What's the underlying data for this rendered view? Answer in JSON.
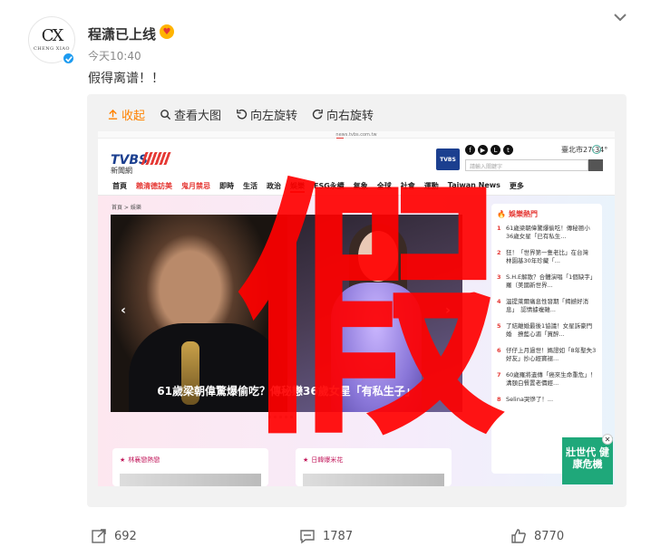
{
  "post": {
    "username": "程潇已上线",
    "avatar_mono": "CX",
    "avatar_sub": "CHENG XIAO",
    "time": "今天10:40",
    "text": "假得离谱！！"
  },
  "toolbar": {
    "collapse": "收起",
    "view_large": "查看大图",
    "rotate_left": "向左旋转",
    "rotate_right": "向右旋转"
  },
  "screenshot": {
    "url": "news.tvbs.com.tw",
    "logo": "TVBS",
    "logo_sub": "新聞網",
    "box_logo": "TVBS",
    "weather": "臺北市27-34°",
    "search_placeholder": "請輸入關鍵字",
    "nav": [
      "首頁",
      "賴清德訪美",
      "鬼月禁忌",
      "即時",
      "生活",
      "政治",
      "娛樂",
      "ESG永續",
      "氣象",
      "全球",
      "社會",
      "運動",
      "Taiwan News",
      "更多"
    ],
    "breadcrumb": "首頁 > 娛樂",
    "carousel_caption": "61歲梁朝偉驚爆偷吃？傳秘戀36歲女星「有私生子」",
    "hot_title": "娛樂熱門",
    "hot_items": [
      {
        "num": "1",
        "text": "61歲梁朝偉驚爆偷吃！傳秘戀小36歲女星「已有私生..."
      },
      {
        "num": "2",
        "text": "狂！「世界第一隻老比」在台灣　林園基30年珍藏「..."
      },
      {
        "num": "3",
        "text": "S.H.E解散？合體演唱「1個缺字」　羅（美國新世界..."
      },
      {
        "num": "4",
        "text": "溫提萊爾痛息性發期「揭撼好消息」　認情據複雜..."
      },
      {
        "num": "5",
        "text": "了結離婚最後1協議！女星訴豪門婚　撩藍心湄「買醉..."
      },
      {
        "num": "6",
        "text": "仔仔上月過世！媽證如「8年聖失3好友」抄心經寶褪..."
      },
      {
        "num": "7",
        "text": "60歲羅將遺傳「癌來生命重危」！溝頤白餐置老價經..."
      },
      {
        "num": "8",
        "text": "Selina哭慘了！..."
      }
    ],
    "card1_title": "林襄戀熱戀",
    "card2_title": "日韓爆米花",
    "ad_text": "壯世代 健康危機",
    "fake_char": "假"
  },
  "footer": {
    "repost": "692",
    "comments": "1787",
    "likes": "8770"
  },
  "colors": {
    "accent": "#ff8200",
    "verified": "#1d9bf0",
    "fake_mark": "#ff0000"
  }
}
